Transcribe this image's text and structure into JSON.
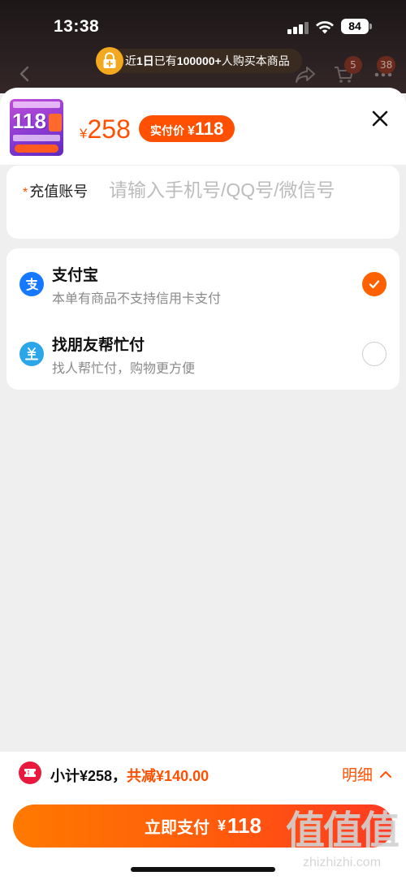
{
  "status_bar": {
    "time": "13:38",
    "battery": "84"
  },
  "background": {
    "banner_prefix": "近",
    "banner_days": "1日",
    "banner_mid": "已有",
    "banner_count": "100000+",
    "banner_suffix": "人购买本商品",
    "cart_badge": "5",
    "more_badge": "38"
  },
  "product": {
    "thumbnail_text": "118",
    "currency": "¥",
    "price": "258",
    "pay_label": "实付价",
    "pay_currency": "¥",
    "pay_amount": "118"
  },
  "account": {
    "required_mark": "*",
    "label": "充值账号",
    "placeholder": "请输入手机号/QQ号/微信号",
    "value": ""
  },
  "payment_methods": [
    {
      "name": "支付宝",
      "subtitle": "本单有商品不支持信用卡支付",
      "icon": "alipay-icon",
      "selected": true
    },
    {
      "name": "找朋友帮忙付",
      "subtitle": "找人帮忙付，购物更方便",
      "icon": "friend-pay-icon",
      "selected": false
    }
  ],
  "footer": {
    "subtotal": "小计¥258，",
    "discount": "共减¥140.00",
    "detail": "明细",
    "pay_label": "立即支付",
    "pay_currency": "¥",
    "pay_amount": "118"
  },
  "watermark": {
    "main": "值值值",
    "sub": "zhizhizhi.com"
  },
  "colors": {
    "accent": "#ff5000",
    "alipay": "#1677ff",
    "friend_pay": "#2ba6e8",
    "coupon": "#e8193c"
  }
}
